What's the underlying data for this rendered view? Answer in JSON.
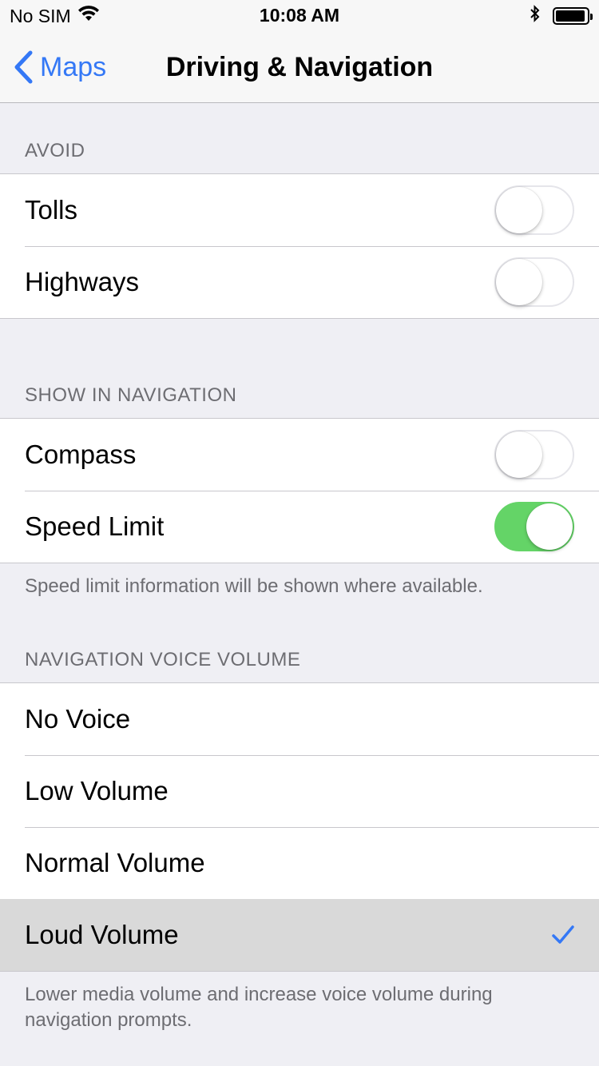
{
  "status_bar": {
    "carrier": "No SIM",
    "time": "10:08 AM",
    "wifi_icon": "wifi-icon",
    "bluetooth_icon": "bluetooth-icon",
    "battery_icon": "battery-icon"
  },
  "nav": {
    "back_label": "Maps",
    "title": "Driving & Navigation"
  },
  "sections": {
    "avoid": {
      "header": "AVOID",
      "rows": [
        {
          "label": "Tolls",
          "on": false
        },
        {
          "label": "Highways",
          "on": false
        }
      ]
    },
    "show": {
      "header": "SHOW IN NAVIGATION",
      "rows": [
        {
          "label": "Compass",
          "on": false
        },
        {
          "label": "Speed Limit",
          "on": true
        }
      ],
      "footer": "Speed limit information will be shown where available."
    },
    "volume": {
      "header": "NAVIGATION VOICE VOLUME",
      "rows": [
        {
          "label": "No Voice"
        },
        {
          "label": "Low Volume"
        },
        {
          "label": "Normal Volume"
        },
        {
          "label": "Loud Volume",
          "selected": true
        }
      ],
      "footer": "Lower media volume and increase voice volume during navigation prompts."
    }
  },
  "colors": {
    "accent": "#3478f6",
    "toggle_on": "#64d467",
    "background": "#efeff4"
  }
}
